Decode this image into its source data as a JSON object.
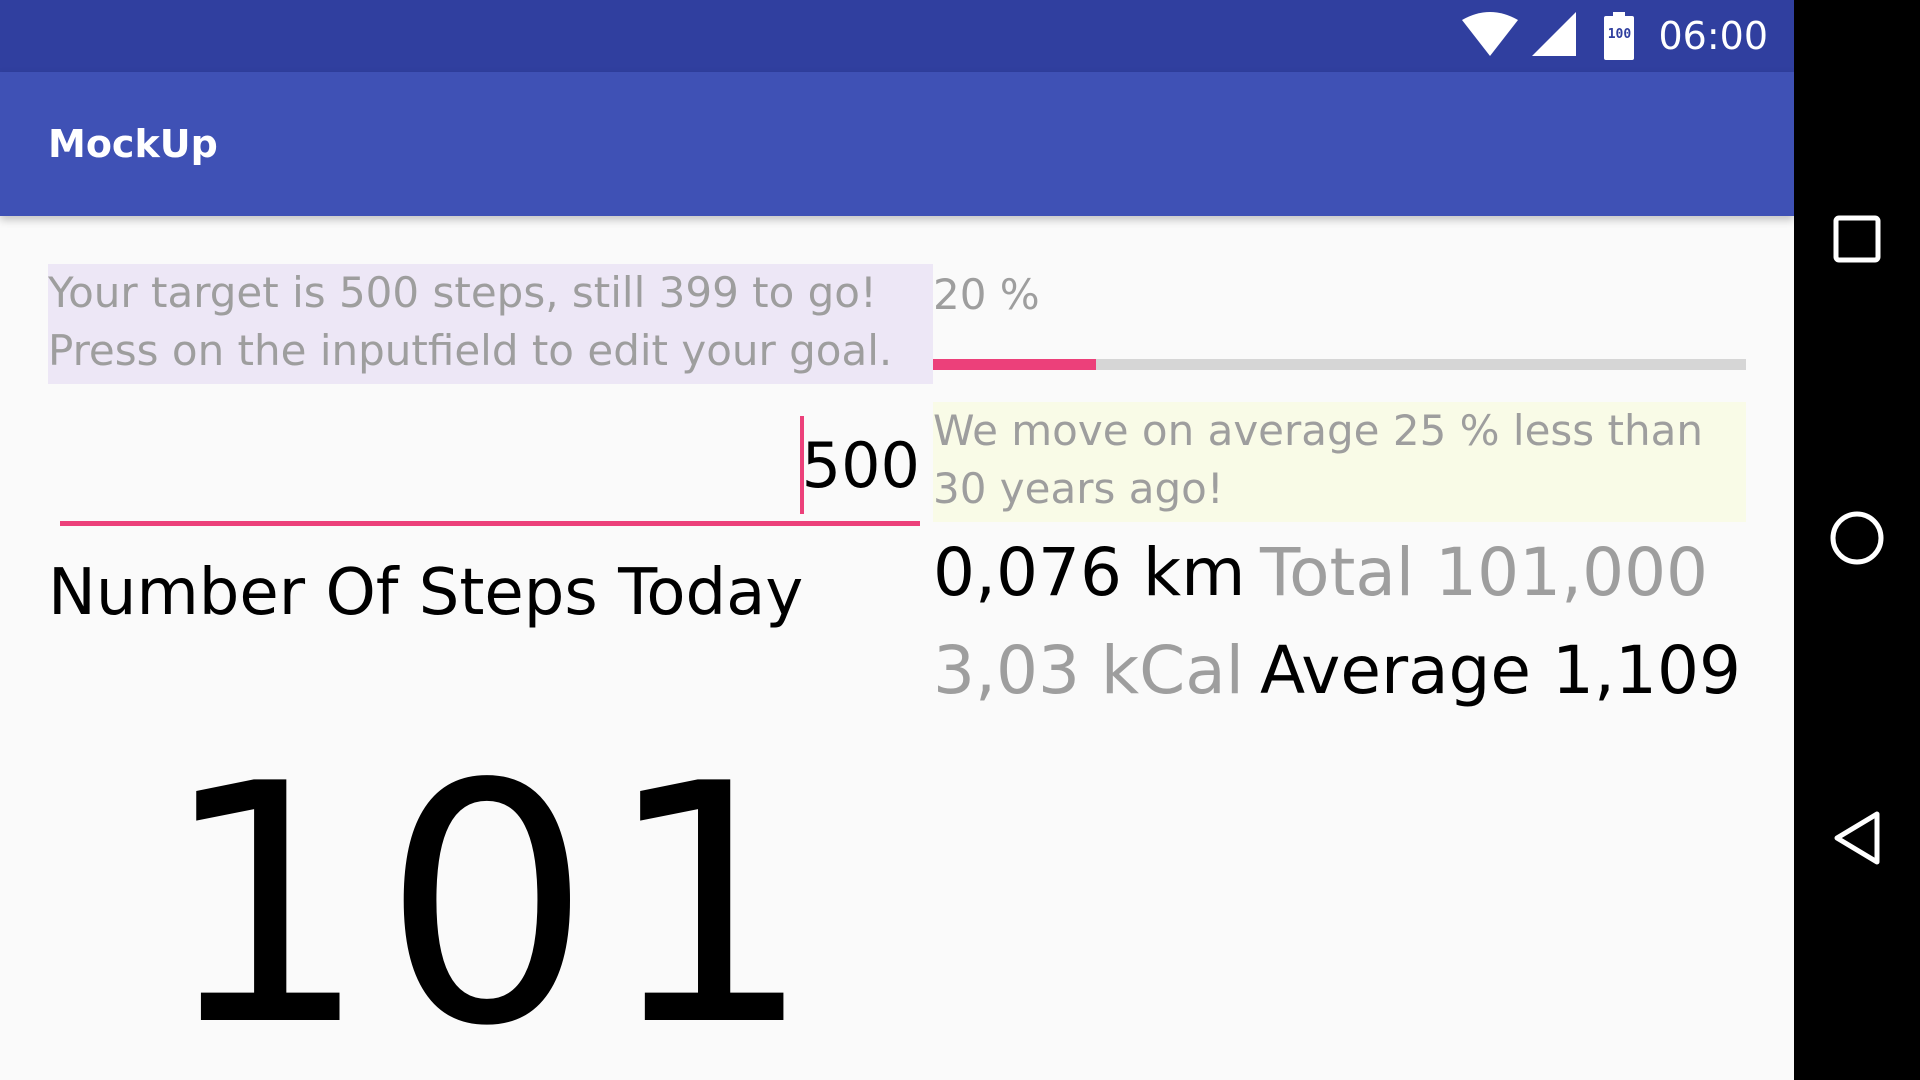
{
  "status_bar": {
    "time": "06:00",
    "battery_level": "100",
    "icons": [
      "wifi-icon",
      "signal-icon",
      "battery-icon"
    ]
  },
  "app_bar": {
    "title": "MockUp"
  },
  "content": {
    "target_line1": "Your target is 500 steps, still 399 to go!",
    "target_line2": "Press on the inputfield to edit your goal.",
    "progress_label": "20 %",
    "progress_fraction": 0.2,
    "goal_input_value": "500",
    "fact_line1": "We move on average 25 % less than",
    "fact_line2": "30 years ago!",
    "distance": "0,076 km",
    "total": "Total 101,000",
    "calories": "3,03 kCal",
    "average": "Average 1,109",
    "steps_heading": "Number Of Steps Today",
    "steps_count": "101"
  },
  "nav_bar": {
    "buttons": [
      "recents-icon",
      "home-icon",
      "back-icon"
    ]
  },
  "colors": {
    "status_bar": "#303f9f",
    "app_bar": "#3f51b5",
    "accent": "#ec407a",
    "target_box_bg": "#ede7f6",
    "fact_box_bg": "#f9fbe7",
    "muted_text": "#9e9e9e"
  }
}
